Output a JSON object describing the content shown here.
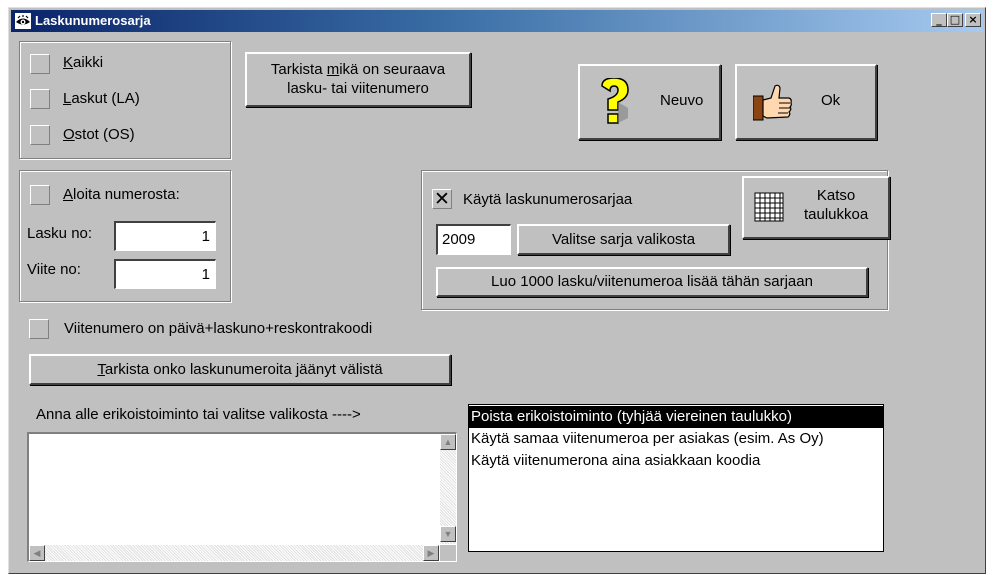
{
  "window": {
    "title": "Laskunumerosarja",
    "minimize": "_",
    "maximize": "□",
    "close": "×"
  },
  "scope": {
    "items": [
      {
        "prefix": "",
        "ul": "K",
        "rest": "aikki"
      },
      {
        "prefix": "",
        "ul": "L",
        "rest": "askut (LA)"
      },
      {
        "prefix": "",
        "ul": "O",
        "rest": "stot (OS)"
      }
    ]
  },
  "check_next": {
    "line1_pre": "Tarkista ",
    "line1_ul": "m",
    "line1_post": "ikä on seuraava",
    "line2": "lasku- tai viitenumero"
  },
  "neuvo": {
    "label": "Neuvo"
  },
  "ok": {
    "label": "Ok"
  },
  "start": {
    "checkbox_ul": "A",
    "checkbox_rest": "loita numerosta:",
    "invoice_label": "Lasku no:",
    "invoice_value": "1",
    "ref_label": "Viite no:",
    "ref_value": "1"
  },
  "series": {
    "use_label": "Käytä laskunumerosarjaa",
    "use_checked": true,
    "year_value": "2009",
    "choose_button": "Valitse sarja valikosta",
    "view_table_line1": "Katso",
    "view_table_line2": "taulukkoa",
    "create_button": "Luo 1000 lasku/viitenumeroa lisää tähän sarjaan"
  },
  "ref_formula": {
    "label": "Viitenumero on päivä+laskuno+reskontrakoodi"
  },
  "check_gaps": {
    "ul": "T",
    "rest": "arkista onko laskunumeroita jäänyt välistä"
  },
  "special": {
    "prompt": "Anna alle erikoistoiminto tai valitse valikosta ---->",
    "options": [
      "Poista erikoistoiminto (tyhjää viereinen taulukko)",
      "Käytä samaa viitenumeroa per asiakas (esim. As Oy)",
      "Käytä viitenumerona aina asiakkaan koodia"
    ],
    "selected_index": 0
  },
  "colors": {
    "titlebar_start": "#0a246a",
    "titlebar_end": "#a6caf0",
    "face": "#c0c0c0",
    "selection": "#000000"
  },
  "icons": [
    "eye-icon",
    "help-question-icon",
    "thumbs-up-icon",
    "grid-table-icon",
    "scroll-up-icon",
    "scroll-down-icon",
    "scroll-left-icon",
    "scroll-right-icon"
  ]
}
